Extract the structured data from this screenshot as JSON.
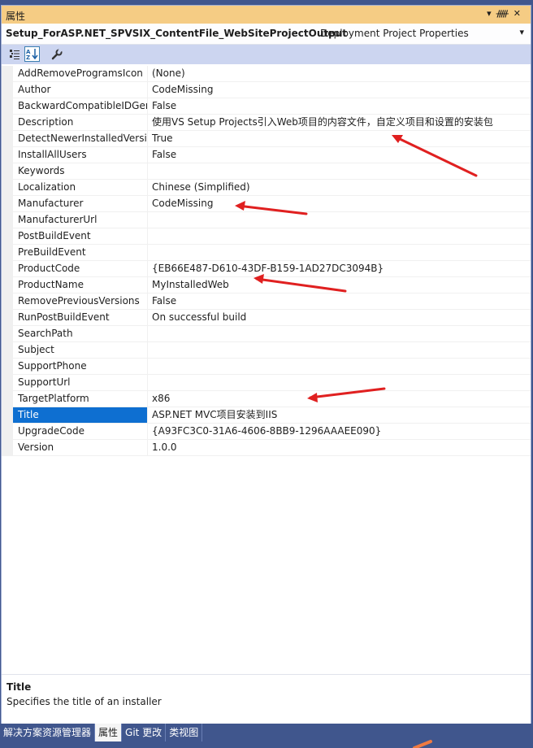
{
  "window": {
    "title": "属性",
    "dropdown_icon": "▾",
    "pin_icon": "ᚏ",
    "close_icon": "✕"
  },
  "object": {
    "name": "Setup_ForASP.NET_SPVSIX_ContentFile_WebSiteProjectOutput",
    "type": "Deployment Project Properties"
  },
  "toolbar": {
    "categorized": "categorized-icon",
    "alphabetical": "alphabetical-icon",
    "property_pages": "wrench-icon"
  },
  "properties": [
    {
      "name": "AddRemoveProgramsIcon",
      "value": "(None)"
    },
    {
      "name": "Author",
      "value": "CodeMissing"
    },
    {
      "name": "BackwardCompatibleIDGen",
      "value": "False"
    },
    {
      "name": "Description",
      "value": "使用VS Setup Projects引入Web项目的内容文件，自定义项目和设置的安装包"
    },
    {
      "name": "DetectNewerInstalledVersio",
      "value": "True"
    },
    {
      "name": "InstallAllUsers",
      "value": "False"
    },
    {
      "name": "Keywords",
      "value": ""
    },
    {
      "name": "Localization",
      "value": "Chinese (Simplified)"
    },
    {
      "name": "Manufacturer",
      "value": "CodeMissing"
    },
    {
      "name": "ManufacturerUrl",
      "value": ""
    },
    {
      "name": "PostBuildEvent",
      "value": ""
    },
    {
      "name": "PreBuildEvent",
      "value": ""
    },
    {
      "name": "ProductCode",
      "value": "{EB66E487-D610-43DF-B159-1AD27DC3094B}"
    },
    {
      "name": "ProductName",
      "value": "MyInstalledWeb"
    },
    {
      "name": "RemovePreviousVersions",
      "value": "False"
    },
    {
      "name": "RunPostBuildEvent",
      "value": "On successful build"
    },
    {
      "name": "SearchPath",
      "value": ""
    },
    {
      "name": "Subject",
      "value": ""
    },
    {
      "name": "SupportPhone",
      "value": ""
    },
    {
      "name": "SupportUrl",
      "value": ""
    },
    {
      "name": "TargetPlatform",
      "value": "x86"
    },
    {
      "name": "Title",
      "value": "ASP.NET MVC项目安装到IIS",
      "selected": true
    },
    {
      "name": "UpgradeCode",
      "value": "{A93FC3C0-31A6-4606-8BB9-1296AAAEE090}"
    },
    {
      "name": "Version",
      "value": "1.0.0"
    }
  ],
  "description": {
    "title": "Title",
    "text": "Specifies the title of an installer"
  },
  "tabs": [
    {
      "label": "解决方案资源管理器",
      "active": false
    },
    {
      "label": "属性",
      "active": true
    },
    {
      "label": "Git 更改",
      "active": false
    },
    {
      "label": "类视图",
      "active": false
    }
  ],
  "colors": {
    "accent": "#0e6fd1",
    "title_bar": "#f5cc84",
    "toolbar": "#ccd5f0",
    "frame": "#40568d",
    "annotation_arrow": "#e02020"
  }
}
